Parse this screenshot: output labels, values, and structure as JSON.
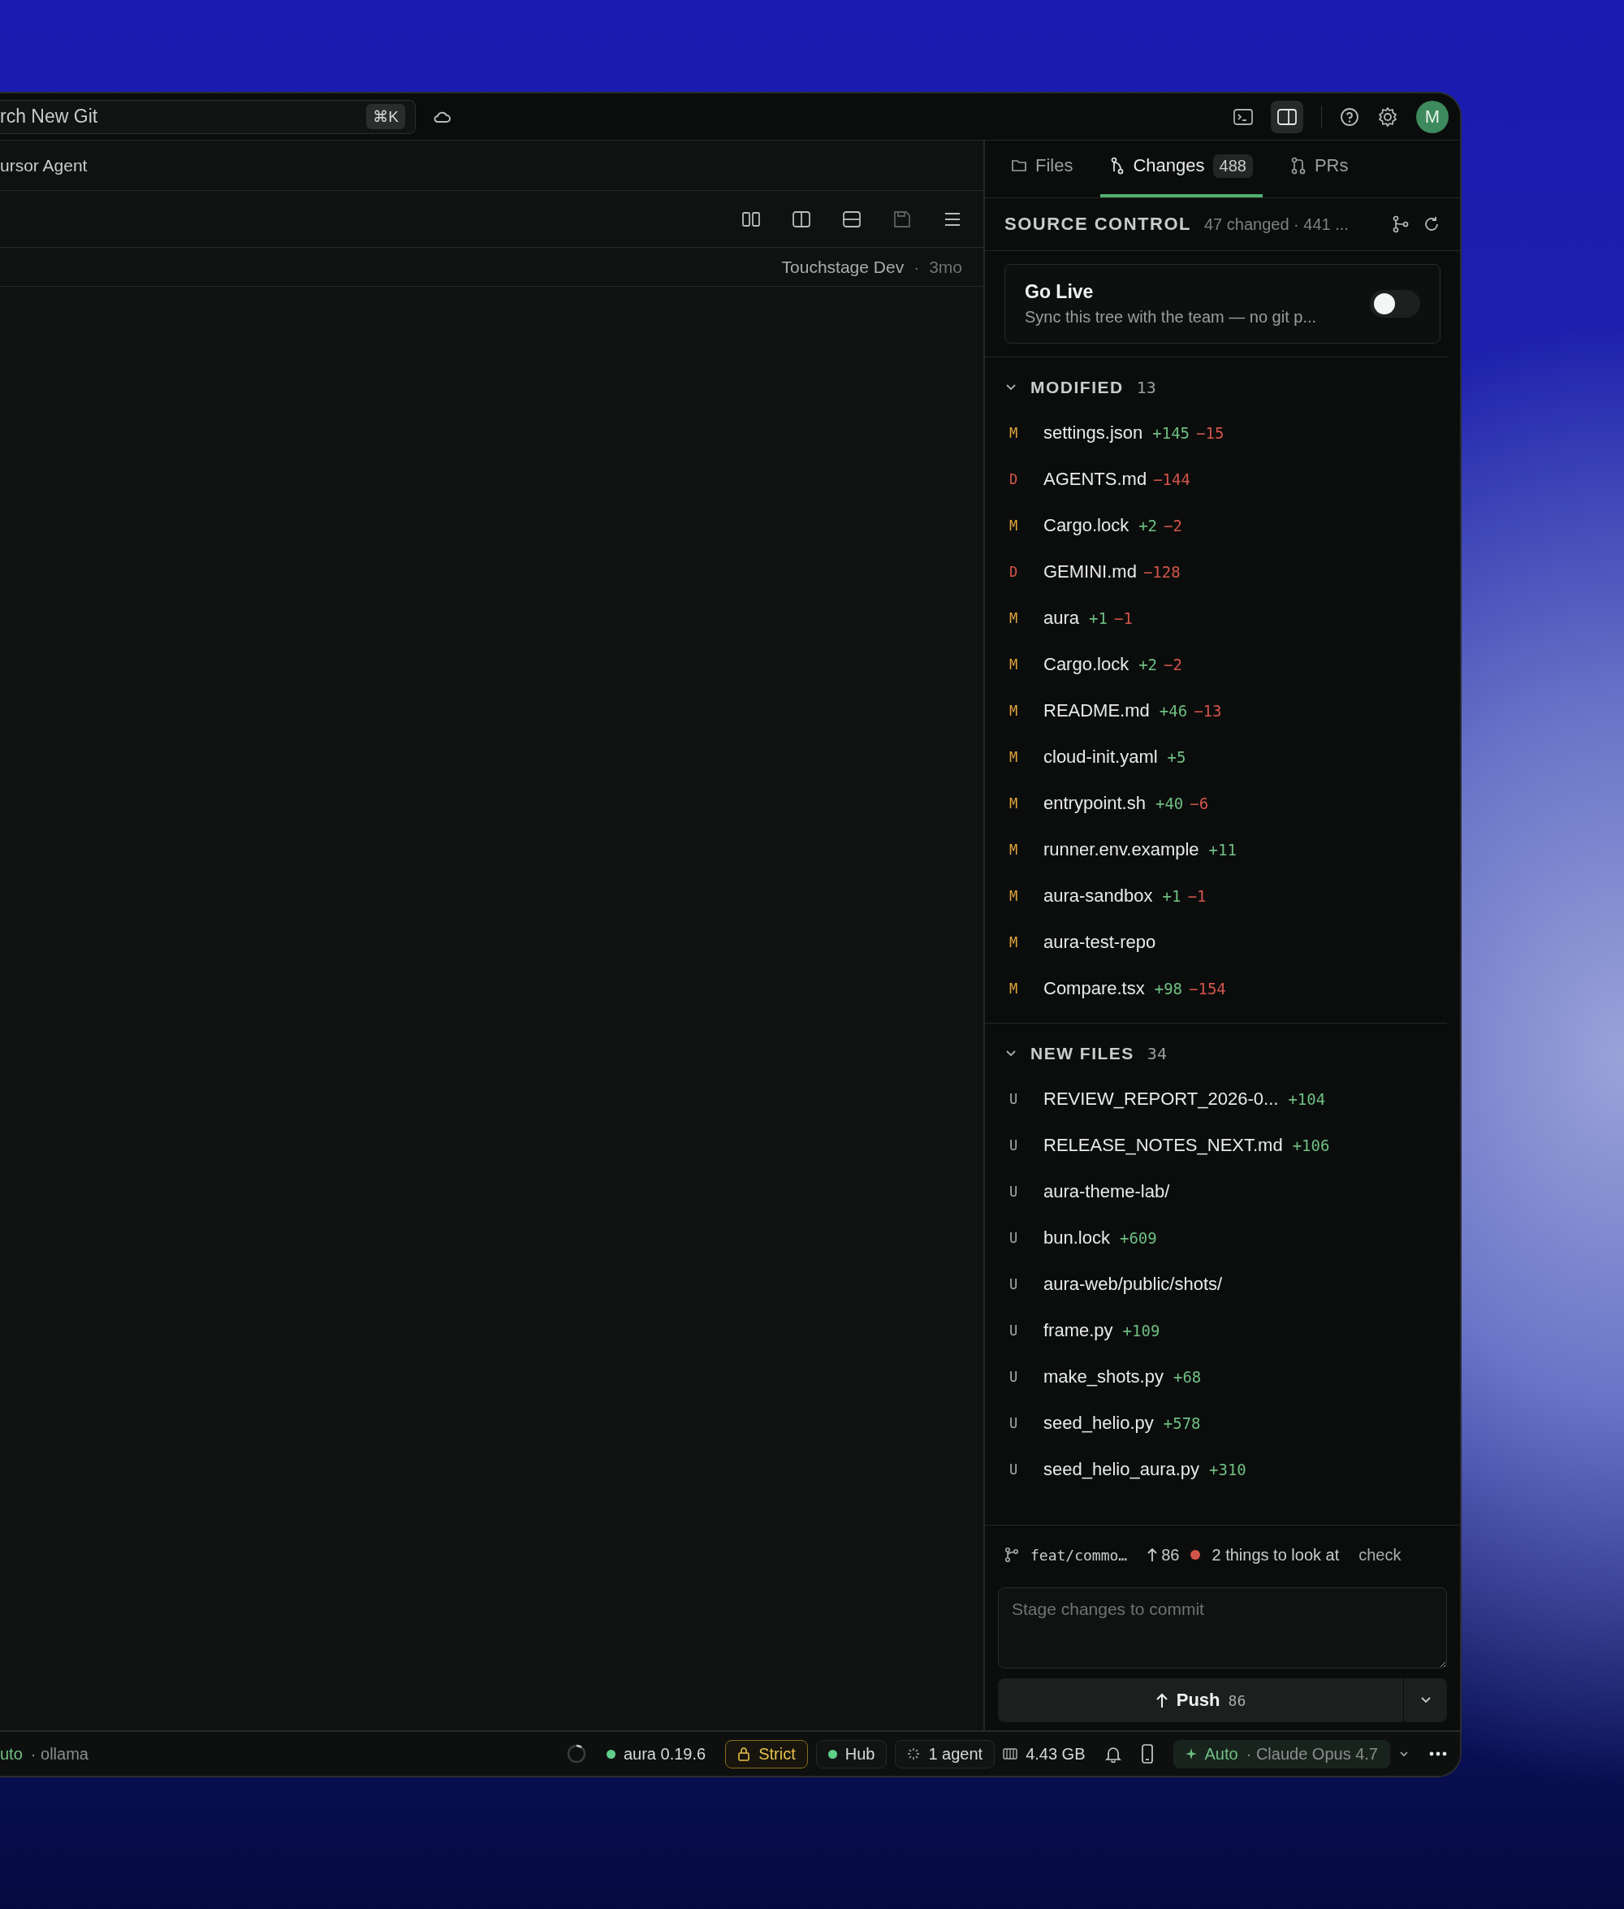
{
  "search": {
    "value": "rch New Git",
    "shortcut": "⌘K"
  },
  "avatar": {
    "initial": "M"
  },
  "editor_tab": {
    "label": "ursor Agent"
  },
  "breadcrumb": {
    "project": "Touchstage Dev",
    "separator": "·",
    "age": "3mo"
  },
  "tabs": [
    {
      "kind": "files",
      "label": "Files",
      "selected": false
    },
    {
      "kind": "changes",
      "label": "Changes",
      "count": "488",
      "selected": true
    },
    {
      "kind": "prs",
      "label": "PRs",
      "selected": false
    }
  ],
  "source_control": {
    "title": "SOURCE CONTROL",
    "summary": "47 changed · 441 ..."
  },
  "go_live": {
    "title": "Go Live",
    "description": "Sync this tree with the team — no git p...",
    "on": false
  },
  "groups": [
    {
      "title": "MODIFIED",
      "count": "13",
      "expanded": true,
      "files": [
        {
          "status": "M",
          "name": "settings.json",
          "added": "+145",
          "removed": "−15"
        },
        {
          "status": "D",
          "name": "AGENTS.md",
          "removed": "−144"
        },
        {
          "status": "M",
          "name": "Cargo.lock",
          "added": "+2",
          "removed": "−2"
        },
        {
          "status": "D",
          "name": "GEMINI.md",
          "removed": "−128"
        },
        {
          "status": "M",
          "name": "aura",
          "added": "+1",
          "removed": "−1"
        },
        {
          "status": "M",
          "name": "Cargo.lock",
          "added": "+2",
          "removed": "−2"
        },
        {
          "status": "M",
          "name": "README.md",
          "added": "+46",
          "removed": "−13"
        },
        {
          "status": "M",
          "name": "cloud-init.yaml",
          "added": "+5"
        },
        {
          "status": "M",
          "name": "entrypoint.sh",
          "added": "+40",
          "removed": "−6"
        },
        {
          "status": "M",
          "name": "runner.env.example",
          "added": "+11"
        },
        {
          "status": "M",
          "name": "aura-sandbox",
          "added": "+1",
          "removed": "−1"
        },
        {
          "status": "M",
          "name": "aura-test-repo"
        },
        {
          "status": "M",
          "name": "Compare.tsx",
          "added": "+98",
          "removed": "−154"
        }
      ]
    },
    {
      "title": "NEW FILES",
      "count": "34",
      "expanded": true,
      "files": [
        {
          "status": "U",
          "name": "REVIEW_REPORT_2026-0...",
          "added": "+104"
        },
        {
          "status": "U",
          "name": "RELEASE_NOTES_NEXT.md",
          "added": "+106"
        },
        {
          "status": "U",
          "name": "aura-theme-lab/"
        },
        {
          "status": "U",
          "name": "bun.lock",
          "added": "+609"
        },
        {
          "status": "U",
          "name": "aura-web/public/shots/"
        },
        {
          "status": "U",
          "name": "frame.py",
          "added": "+109"
        },
        {
          "status": "U",
          "name": "make_shots.py",
          "added": "+68"
        },
        {
          "status": "U",
          "name": "seed_helio.py",
          "added": "+578"
        },
        {
          "status": "U",
          "name": "seed_helio_aura.py",
          "added": "+310"
        }
      ]
    }
  ],
  "footer": {
    "branch": "feat/commo…",
    "ahead": "86",
    "issues": "2 things to look at",
    "check": "check"
  },
  "commit": {
    "placeholder": "Stage changes to commit"
  },
  "push": {
    "label": "Push",
    "count": "86"
  },
  "status_bar": {
    "mode": "uto",
    "provider": "· ollama",
    "version": "aura 0.19.6",
    "strict": "Strict",
    "hub": "Hub",
    "agents": "1 agent",
    "memory": "4.43 GB",
    "model_mode": "Auto",
    "model_name": "· Claude Opus 4.7"
  }
}
